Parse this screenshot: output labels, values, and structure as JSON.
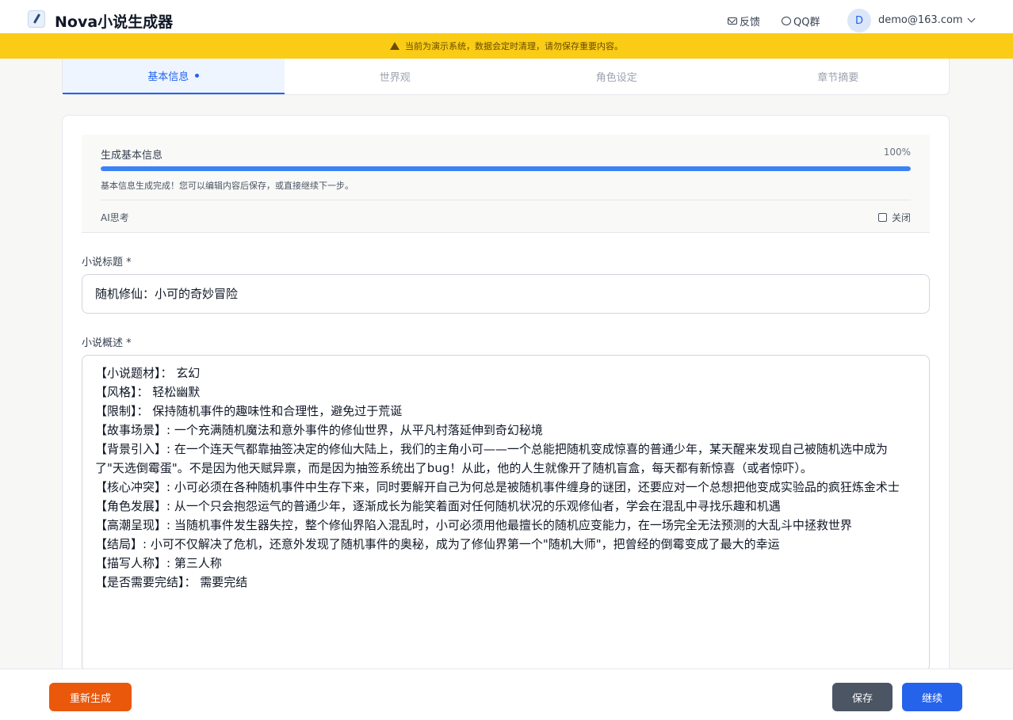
{
  "header": {
    "app_title": "Nova小说生成器",
    "feedback_label": "反馈",
    "qq_label": "QQ群",
    "avatar_initial": "D",
    "user_email": "demo@163.com"
  },
  "banner": {
    "text": "当前为演示系统，数据会定时清理，请勿保存重要内容。"
  },
  "tabs": [
    {
      "label": "基本信息",
      "active": true
    },
    {
      "label": "世界观",
      "active": false
    },
    {
      "label": "角色设定",
      "active": false
    },
    {
      "label": "章节摘要",
      "active": false
    }
  ],
  "progress": {
    "label": "生成基本信息",
    "percent_text": "100%",
    "value": 100,
    "message": "基本信息生成完成！您可以编辑内容后保存，或直接继续下一步。",
    "ai_label": "AI思考",
    "toggle_label": "关闭"
  },
  "form": {
    "title_label": "小说标题 *",
    "title_value": "随机修仙：小可的奇妙冒险",
    "desc_label": "小说概述 *",
    "desc_value": "【小说题材】： 玄幻\n【风格】： 轻松幽默\n【限制】： 保持随机事件的趣味性和合理性，避免过于荒诞\n【故事场景】: 一个充满随机魔法和意外事件的修仙世界，从平凡村落延伸到奇幻秘境\n【背景引入】: 在一个连天气都靠抽签决定的修仙大陆上，我们的主角小可——一个总能把随机变成惊喜的普通少年，某天醒来发现自己被随机选中成为了\"天选倒霉蛋\"。不是因为他天赋异禀，而是因为抽签系统出了bug！从此，他的人生就像开了随机盲盒，每天都有新惊喜（或者惊吓）。\n【核心冲突】: 小可必须在各种随机事件中生存下来，同时要解开自己为何总是被随机事件缠身的谜团，还要应对一个总想把他变成实验品的疯狂炼金术士\n【角色发展】: 从一个只会抱怨运气的普通少年，逐渐成长为能笑着面对任何随机状况的乐观修仙者，学会在混乱中寻找乐趣和机遇\n【高潮呈现】: 当随机事件发生器失控，整个修仙界陷入混乱时，小可必须用他最擅长的随机应变能力，在一场完全无法预测的大乱斗中拯救世界\n【结局】: 小可不仅解决了危机，还意外发现了随机事件的奥秘，成为了修仙界第一个\"随机大师\"，把曾经的倒霉变成了最大的幸运\n【描写人称】: 第三人称\n【是否需要完结】： 需要完结"
  },
  "footer": {
    "regen_label": "重新生成",
    "save_label": "保存",
    "next_label": "继续"
  }
}
